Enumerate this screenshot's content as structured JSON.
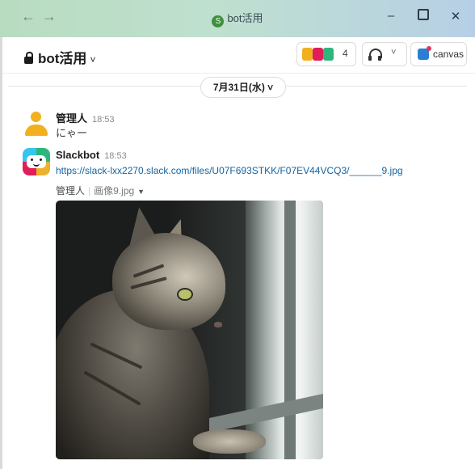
{
  "window": {
    "title": "bot活用",
    "app_icon_letter": "S",
    "back_icon": "←",
    "forward_icon": "→",
    "minimize_icon": "–",
    "close_icon": "✕"
  },
  "channel": {
    "name": "bot活用",
    "member_count": "4",
    "canvas_label": "canvas"
  },
  "date_divider": "7月31日(水) ˅",
  "messages": [
    {
      "sender": "管理人",
      "time": "18:53",
      "text": "にゃー"
    },
    {
      "sender": "Slackbot",
      "time": "18:53",
      "link": "https://slack-lxx2270.slack.com/files/U07F693STKK/F07EV44VCQ3/______9.jpg",
      "file": {
        "uploader": "管理人",
        "filename": "画像9.jpg"
      }
    }
  ],
  "colors": {
    "link": "#1264a3",
    "titlebar_left": "#b8dcc0",
    "titlebar_right": "#b7cfe6",
    "avatar_yellow": "#f2b01e"
  }
}
